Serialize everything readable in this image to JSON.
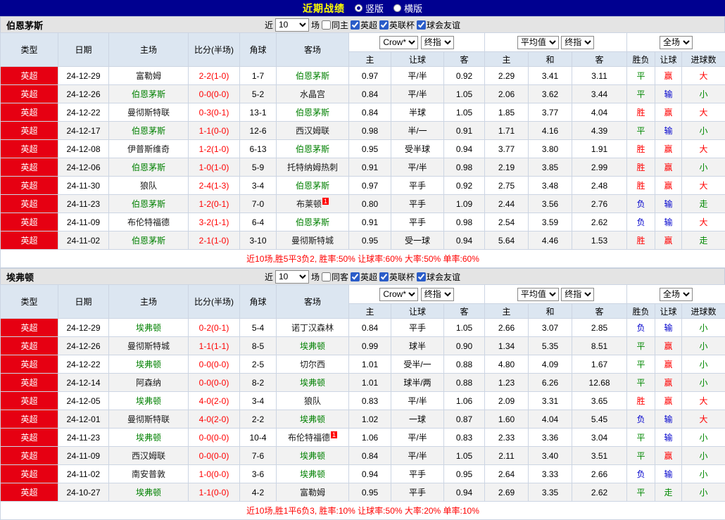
{
  "topbar": {
    "title": "近期战绩",
    "radios": [
      {
        "label": "竖版",
        "selected": true
      },
      {
        "label": "横版",
        "selected": false
      }
    ]
  },
  "colors": {
    "topbar_bg": "#000090",
    "title_color": "#ffff00",
    "league_badge_bg": "#e60012",
    "focal_team": "#008000",
    "win": "#ff0000",
    "draw": "#008800",
    "lose": "#0000cc"
  },
  "result_class_map": {
    "胜": "res-r",
    "赢": "res-r",
    "大": "res-r",
    "平": "res-g",
    "走": "res-g",
    "小": "res-g",
    "负": "res-b",
    "输": "res-b"
  },
  "table_header": {
    "static_cols": [
      "类型",
      "日期",
      "主场",
      "比分(半场)",
      "角球",
      "客场"
    ],
    "group1_selects": [
      "Crow*",
      "终指"
    ],
    "group2_selects": [
      "平均值",
      "终指"
    ],
    "group3_selects": [
      "全场"
    ],
    "sub_cols": [
      "主",
      "让球",
      "客",
      "主",
      "和",
      "客",
      "胜负",
      "让球",
      "进球数"
    ]
  },
  "sections": [
    {
      "team": "伯恩茅斯",
      "filter": {
        "near": "近",
        "count": "10",
        "unit": "场",
        "same": "同主",
        "same_checked": false,
        "leagues": [
          {
            "label": "英超",
            "checked": true
          },
          {
            "label": "英联杯",
            "checked": true
          },
          {
            "label": "球会友谊",
            "checked": true
          }
        ]
      },
      "rows": [
        {
          "league": "英超",
          "date": "24-12-29",
          "home": {
            "name": "富勒姆",
            "focal": false
          },
          "score": "2-2(1-0)",
          "corner": "1-7",
          "away": {
            "name": "伯恩茅斯",
            "focal": true
          },
          "odds": [
            "0.97",
            "平/半",
            "0.92"
          ],
          "avgs": [
            "2.29",
            "3.41",
            "3.11"
          ],
          "results": [
            "平",
            "赢",
            "大"
          ]
        },
        {
          "league": "英超",
          "date": "24-12-26",
          "home": {
            "name": "伯恩茅斯",
            "focal": true
          },
          "score": "0-0(0-0)",
          "corner": "5-2",
          "away": {
            "name": "水晶宫",
            "focal": false
          },
          "odds": [
            "0.84",
            "平/半",
            "1.05"
          ],
          "avgs": [
            "2.06",
            "3.62",
            "3.44"
          ],
          "results": [
            "平",
            "输",
            "小"
          ]
        },
        {
          "league": "英超",
          "date": "24-12-22",
          "home": {
            "name": "曼彻斯特联",
            "focal": false
          },
          "score": "0-3(0-1)",
          "corner": "13-1",
          "away": {
            "name": "伯恩茅斯",
            "focal": true
          },
          "odds": [
            "0.84",
            "半球",
            "1.05"
          ],
          "avgs": [
            "1.85",
            "3.77",
            "4.04"
          ],
          "results": [
            "胜",
            "赢",
            "大"
          ]
        },
        {
          "league": "英超",
          "date": "24-12-17",
          "home": {
            "name": "伯恩茅斯",
            "focal": true
          },
          "score": "1-1(0-0)",
          "corner": "12-6",
          "away": {
            "name": "西汉姆联",
            "focal": false
          },
          "odds": [
            "0.98",
            "半/一",
            "0.91"
          ],
          "avgs": [
            "1.71",
            "4.16",
            "4.39"
          ],
          "results": [
            "平",
            "输",
            "小"
          ]
        },
        {
          "league": "英超",
          "date": "24-12-08",
          "home": {
            "name": "伊普斯维奇",
            "focal": false
          },
          "score": "1-2(1-0)",
          "corner": "6-13",
          "away": {
            "name": "伯恩茅斯",
            "focal": true
          },
          "odds": [
            "0.95",
            "受半球",
            "0.94"
          ],
          "avgs": [
            "3.77",
            "3.80",
            "1.91"
          ],
          "results": [
            "胜",
            "赢",
            "大"
          ]
        },
        {
          "league": "英超",
          "date": "24-12-06",
          "home": {
            "name": "伯恩茅斯",
            "focal": true
          },
          "score": "1-0(1-0)",
          "corner": "5-9",
          "away": {
            "name": "托特纳姆热刺",
            "focal": false
          },
          "odds": [
            "0.91",
            "平/半",
            "0.98"
          ],
          "avgs": [
            "2.19",
            "3.85",
            "2.99"
          ],
          "results": [
            "胜",
            "赢",
            "小"
          ]
        },
        {
          "league": "英超",
          "date": "24-11-30",
          "home": {
            "name": "狼队",
            "focal": false
          },
          "score": "2-4(1-3)",
          "corner": "3-4",
          "away": {
            "name": "伯恩茅斯",
            "focal": true
          },
          "odds": [
            "0.97",
            "平手",
            "0.92"
          ],
          "avgs": [
            "2.75",
            "3.48",
            "2.48"
          ],
          "results": [
            "胜",
            "赢",
            "大"
          ]
        },
        {
          "league": "英超",
          "date": "24-11-23",
          "home": {
            "name": "伯恩茅斯",
            "focal": true
          },
          "score": "1-2(0-1)",
          "corner": "7-0",
          "away": {
            "name": "布莱顿",
            "focal": false,
            "badge": "1"
          },
          "odds": [
            "0.80",
            "平手",
            "1.09"
          ],
          "avgs": [
            "2.44",
            "3.56",
            "2.76"
          ],
          "results": [
            "负",
            "输",
            "走"
          ]
        },
        {
          "league": "英超",
          "date": "24-11-09",
          "home": {
            "name": "布伦特福德",
            "focal": false
          },
          "score": "3-2(1-1)",
          "corner": "6-4",
          "away": {
            "name": "伯恩茅斯",
            "focal": true
          },
          "odds": [
            "0.91",
            "平手",
            "0.98"
          ],
          "avgs": [
            "2.54",
            "3.59",
            "2.62"
          ],
          "results": [
            "负",
            "输",
            "大"
          ]
        },
        {
          "league": "英超",
          "date": "24-11-02",
          "home": {
            "name": "伯恩茅斯",
            "focal": true
          },
          "score": "2-1(1-0)",
          "corner": "3-10",
          "away": {
            "name": "曼彻斯特城",
            "focal": false
          },
          "odds": [
            "0.95",
            "受一球",
            "0.94"
          ],
          "avgs": [
            "5.64",
            "4.46",
            "1.53"
          ],
          "results": [
            "胜",
            "赢",
            "走"
          ]
        }
      ],
      "summary": "近10场,胜5平3负2, 胜率:50% 让球率:60% 大率:50% 单率:60%"
    },
    {
      "team": "埃弗顿",
      "filter": {
        "near": "近",
        "count": "10",
        "unit": "场",
        "same": "同客",
        "same_checked": false,
        "leagues": [
          {
            "label": "英超",
            "checked": true
          },
          {
            "label": "英联杯",
            "checked": true
          },
          {
            "label": "球会友谊",
            "checked": true
          }
        ]
      },
      "rows": [
        {
          "league": "英超",
          "date": "24-12-29",
          "home": {
            "name": "埃弗顿",
            "focal": true
          },
          "score": "0-2(0-1)",
          "corner": "5-4",
          "away": {
            "name": "诺丁汉森林",
            "focal": false
          },
          "odds": [
            "0.84",
            "平手",
            "1.05"
          ],
          "avgs": [
            "2.66",
            "3.07",
            "2.85"
          ],
          "results": [
            "负",
            "输",
            "小"
          ]
        },
        {
          "league": "英超",
          "date": "24-12-26",
          "home": {
            "name": "曼彻斯特城",
            "focal": false
          },
          "score": "1-1(1-1)",
          "corner": "8-5",
          "away": {
            "name": "埃弗顿",
            "focal": true
          },
          "odds": [
            "0.99",
            "球半",
            "0.90"
          ],
          "avgs": [
            "1.34",
            "5.35",
            "8.51"
          ],
          "results": [
            "平",
            "赢",
            "小"
          ]
        },
        {
          "league": "英超",
          "date": "24-12-22",
          "home": {
            "name": "埃弗顿",
            "focal": true
          },
          "score": "0-0(0-0)",
          "corner": "2-5",
          "away": {
            "name": "切尔西",
            "focal": false
          },
          "odds": [
            "1.01",
            "受半/一",
            "0.88"
          ],
          "avgs": [
            "4.80",
            "4.09",
            "1.67"
          ],
          "results": [
            "平",
            "赢",
            "小"
          ]
        },
        {
          "league": "英超",
          "date": "24-12-14",
          "home": {
            "name": "阿森纳",
            "focal": false
          },
          "score": "0-0(0-0)",
          "corner": "8-2",
          "away": {
            "name": "埃弗顿",
            "focal": true
          },
          "odds": [
            "1.01",
            "球半/两",
            "0.88"
          ],
          "avgs": [
            "1.23",
            "6.26",
            "12.68"
          ],
          "results": [
            "平",
            "赢",
            "小"
          ]
        },
        {
          "league": "英超",
          "date": "24-12-05",
          "home": {
            "name": "埃弗顿",
            "focal": true
          },
          "score": "4-0(2-0)",
          "corner": "3-4",
          "away": {
            "name": "狼队",
            "focal": false
          },
          "odds": [
            "0.83",
            "平/半",
            "1.06"
          ],
          "avgs": [
            "2.09",
            "3.31",
            "3.65"
          ],
          "results": [
            "胜",
            "赢",
            "大"
          ]
        },
        {
          "league": "英超",
          "date": "24-12-01",
          "home": {
            "name": "曼彻斯特联",
            "focal": false
          },
          "score": "4-0(2-0)",
          "corner": "2-2",
          "away": {
            "name": "埃弗顿",
            "focal": true
          },
          "odds": [
            "1.02",
            "一球",
            "0.87"
          ],
          "avgs": [
            "1.60",
            "4.04",
            "5.45"
          ],
          "results": [
            "负",
            "输",
            "大"
          ]
        },
        {
          "league": "英超",
          "date": "24-11-23",
          "home": {
            "name": "埃弗顿",
            "focal": true
          },
          "score": "0-0(0-0)",
          "corner": "10-4",
          "away": {
            "name": "布伦特福德",
            "focal": false,
            "badge": "1"
          },
          "odds": [
            "1.06",
            "平/半",
            "0.83"
          ],
          "avgs": [
            "2.33",
            "3.36",
            "3.04"
          ],
          "results": [
            "平",
            "输",
            "小"
          ]
        },
        {
          "league": "英超",
          "date": "24-11-09",
          "home": {
            "name": "西汉姆联",
            "focal": false
          },
          "score": "0-0(0-0)",
          "corner": "7-6",
          "away": {
            "name": "埃弗顿",
            "focal": true
          },
          "odds": [
            "0.84",
            "平/半",
            "1.05"
          ],
          "avgs": [
            "2.11",
            "3.40",
            "3.51"
          ],
          "results": [
            "平",
            "赢",
            "小"
          ]
        },
        {
          "league": "英超",
          "date": "24-11-02",
          "home": {
            "name": "南安普敦",
            "focal": false
          },
          "score": "1-0(0-0)",
          "corner": "3-6",
          "away": {
            "name": "埃弗顿",
            "focal": true
          },
          "odds": [
            "0.94",
            "平手",
            "0.95"
          ],
          "avgs": [
            "2.64",
            "3.33",
            "2.66"
          ],
          "results": [
            "负",
            "输",
            "小"
          ]
        },
        {
          "league": "英超",
          "date": "24-10-27",
          "home": {
            "name": "埃弗顿",
            "focal": true
          },
          "score": "1-1(0-0)",
          "corner": "4-2",
          "away": {
            "name": "富勒姆",
            "focal": false
          },
          "odds": [
            "0.95",
            "平手",
            "0.94"
          ],
          "avgs": [
            "2.69",
            "3.35",
            "2.62"
          ],
          "results": [
            "平",
            "走",
            "小"
          ]
        }
      ],
      "summary": "近10场,胜1平6负3, 胜率:10% 让球率:50% 大率:20% 单率:10%"
    }
  ]
}
